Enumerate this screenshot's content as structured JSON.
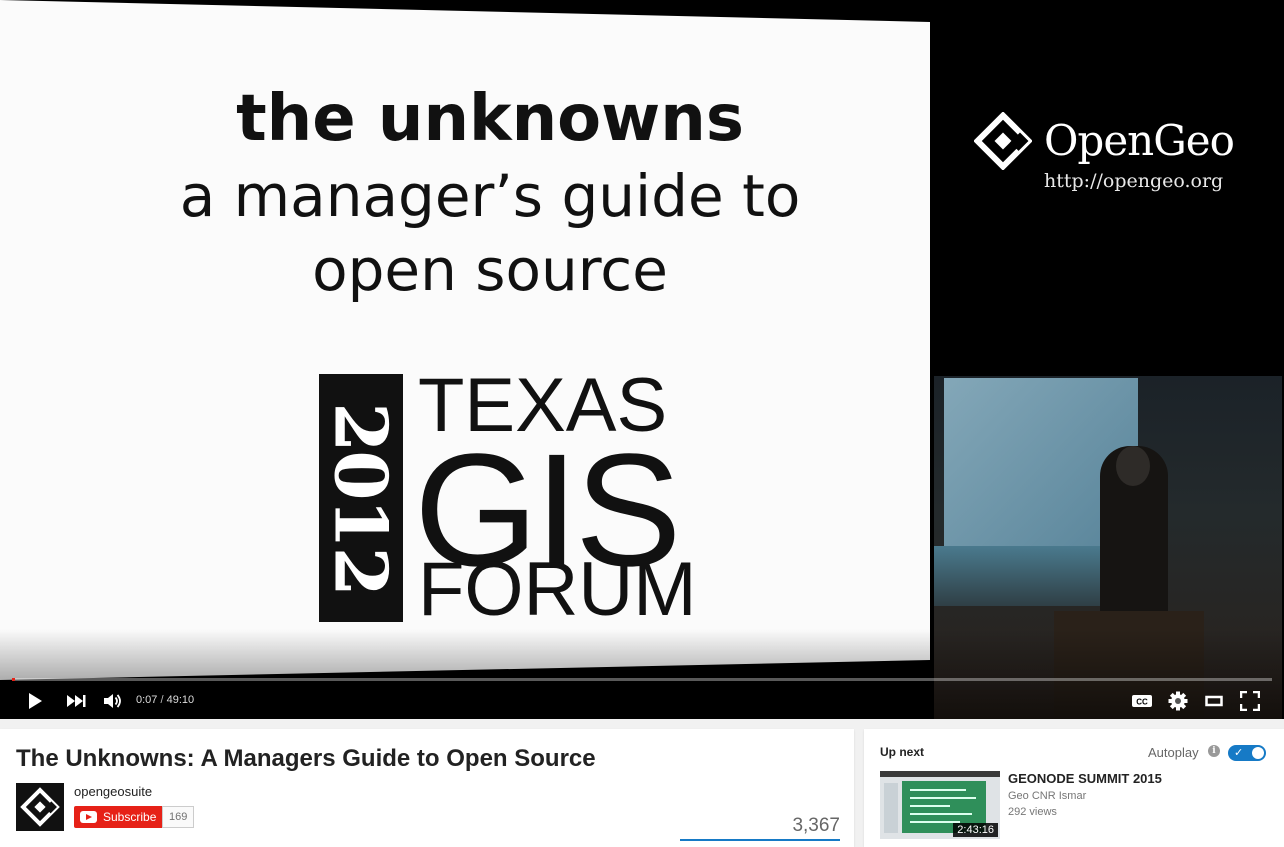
{
  "player": {
    "slide": {
      "title_line1": "the unknowns",
      "title_line2": "a manager’s guide to",
      "title_line3": "open source",
      "forum_year": "2012",
      "forum_line1": "TEXAS",
      "forum_line2": "GIS",
      "forum_line3": "FORUM"
    },
    "brand": {
      "name": "OpenGeo",
      "url": "http://opengeo.org"
    },
    "progress_fraction": 0.0024,
    "time_current": "0:07",
    "time_separator": " / ",
    "time_total": "49:10",
    "icons": {
      "play": "play-icon",
      "next": "skip-next-icon",
      "volume": "volume-icon",
      "captions": "captions-icon",
      "settings": "gear-icon",
      "theater": "theater-mode-icon",
      "fullscreen": "fullscreen-icon"
    },
    "captions_label": "CC",
    "accent": "#e62117"
  },
  "video": {
    "title": "The Unknowns: A Managers Guide to Open Source",
    "channel_name": "opengeosuite",
    "subscribe_label": "Subscribe",
    "subscriber_count": "169",
    "view_count": "3,367"
  },
  "upnext": {
    "label": "Up next",
    "autoplay_label": "Autoplay",
    "autoplay_on": true,
    "info_glyph": "i",
    "item": {
      "title": "GEONODE SUMMIT 2015",
      "channel": "Geo CNR Ismar",
      "views": "292 views",
      "duration": "2:43:16"
    }
  }
}
